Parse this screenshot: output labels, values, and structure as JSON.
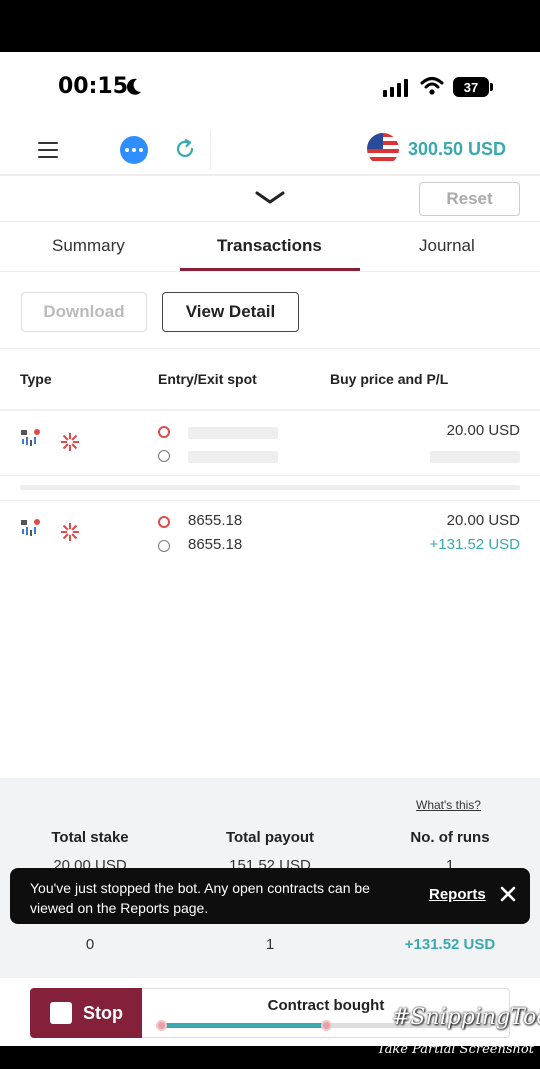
{
  "status_bar": {
    "time": "00:15",
    "battery": "37"
  },
  "header": {
    "balance": "300.50 USD"
  },
  "controls": {
    "reset_label": "Reset"
  },
  "tabs": [
    {
      "label": "Summary",
      "active": false
    },
    {
      "label": "Transactions",
      "active": true
    },
    {
      "label": "Journal",
      "active": false
    }
  ],
  "actions": {
    "download_label": "Download",
    "view_detail_label": "View Detail"
  },
  "table": {
    "headers": {
      "type": "Type",
      "spot": "Entry/Exit spot",
      "price": "Buy price and P/L"
    },
    "rows": [
      {
        "entry_spot": "",
        "exit_spot": "",
        "buy_price": "20.00 USD",
        "pl": ""
      },
      {
        "entry_spot": "8655.18",
        "exit_spot": "8655.18",
        "buy_price": "20.00 USD",
        "pl": "+131.52 USD"
      }
    ]
  },
  "summary": {
    "whats_this": "What's this?",
    "total_stake_label": "Total stake",
    "total_stake": "20.00 USD",
    "total_payout_label": "Total payout",
    "total_payout": "151.52 USD",
    "runs_label": "No. of runs",
    "runs": "1",
    "lost": "0",
    "won": "1",
    "profit_loss": "+131.52 USD"
  },
  "toast": {
    "message": "You've just stopped the bot. Any open contracts can be viewed on the Reports page.",
    "link": "Reports"
  },
  "footer": {
    "stop_label": "Stop",
    "status": "Contract bought",
    "progress": 0.5
  },
  "watermark": {
    "title": "#SnippingTool",
    "subtitle": "Take Partial Screenshot"
  },
  "colors": {
    "accent": "#85203a",
    "profit": "#3aa9ae",
    "info": "#2f8fff"
  }
}
